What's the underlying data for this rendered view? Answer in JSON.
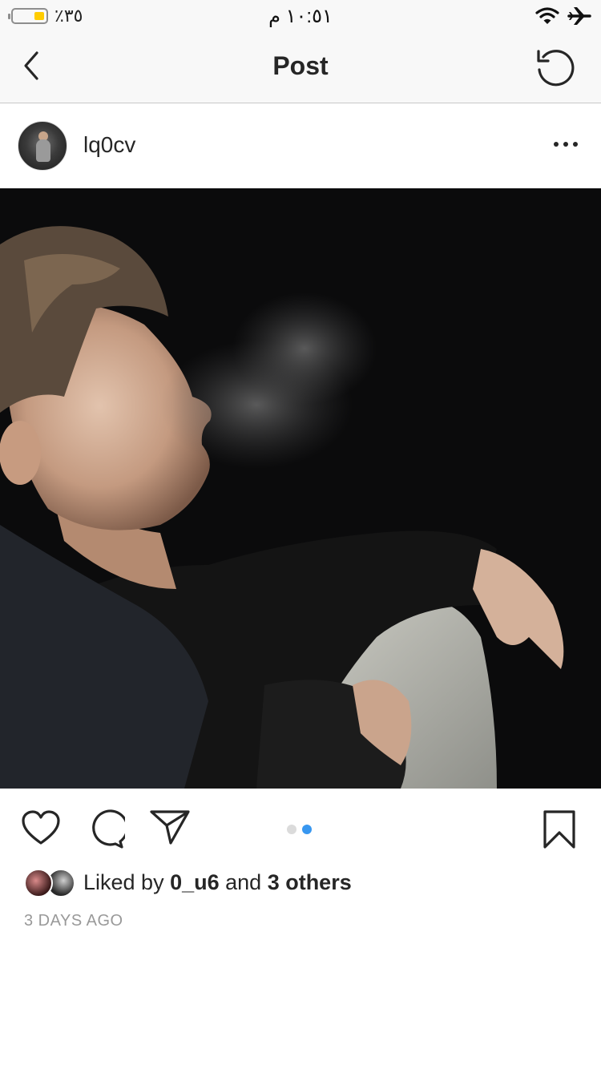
{
  "status_bar": {
    "battery_percent": "٪٣٥",
    "time": "١٠:٥١ م",
    "battery_fill_color": "#ffcc00",
    "icons": [
      "wifi-icon",
      "airplane-icon"
    ]
  },
  "nav": {
    "title": "Post",
    "back_icon": "chevron-left-icon",
    "refresh_icon": "refresh-icon"
  },
  "post": {
    "username": "lq0cv",
    "more_icon": "more-horizontal-icon",
    "photo_alt": "",
    "carousel": {
      "count": 2,
      "active_index": 1,
      "active_color": "#3897f0",
      "inactive_color": "#dbdbdb"
    },
    "liked_by_prefix": "Liked by ",
    "liked_by_user": "0_u6",
    "liked_by_and": " and ",
    "liked_by_others": "3 others",
    "timestamp": "3 DAYS AGO"
  },
  "actions": {
    "icons": [
      "heart-icon",
      "comment-icon",
      "share-icon",
      "bookmark-icon"
    ]
  }
}
